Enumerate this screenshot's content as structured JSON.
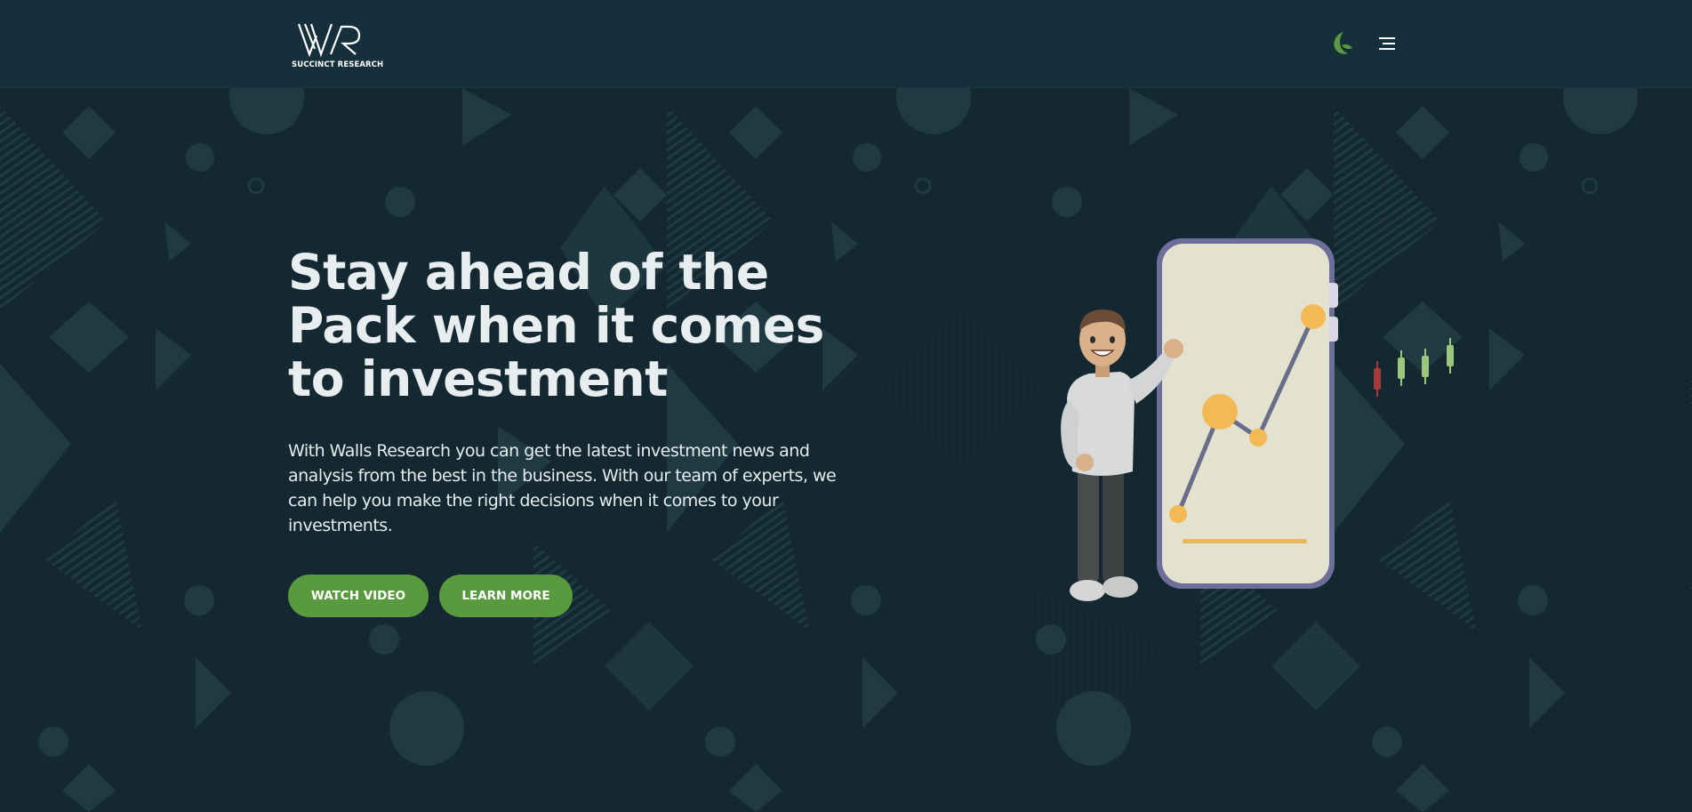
{
  "brand": {
    "logo_icon": "wr-monogram-logo",
    "caption": "SUCCINCT RESEARCH"
  },
  "header": {
    "theme_toggle_icon": "moon-icon",
    "menu_icon": "hamburger-menu-icon"
  },
  "hero": {
    "title": "Stay ahead of the Pack when it comes to investment",
    "description": "With Walls Research you can get the latest investment news and analysis from the best in the business. With our team of experts, we can help you make the right decisions when it comes to your investments.",
    "watch_video_label": "WATCH VIDEO",
    "learn_more_label": "LEARN MORE",
    "illustration": "character-presenting-phone-chart-illustration"
  },
  "colors": {
    "background": "#132830",
    "header": "#15303a",
    "accent_green": "#5a9a3e",
    "text_light": "#e8edef",
    "phone_body": "#e3e2cf",
    "phone_frame": "#6d6e9a",
    "chart_dot": "#f3b955",
    "candle_red": "#a83a3a",
    "candle_green": "#9cc67a"
  }
}
